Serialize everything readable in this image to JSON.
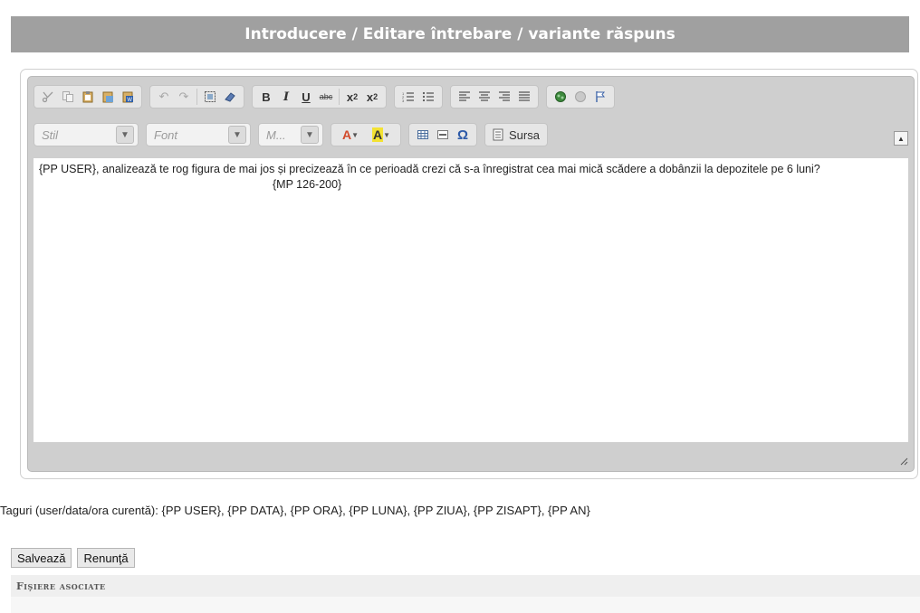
{
  "dialog": {
    "title": "Introducere / Editare întrebare / variante răspuns"
  },
  "toolbar": {
    "row1_icons": [
      "cut-icon",
      "copy-icon",
      "paste-icon",
      "paste-text-icon",
      "paste-word-icon",
      "undo-icon",
      "redo-icon",
      "select-all-icon",
      "remove-format-icon",
      "bold-icon",
      "italic-icon",
      "underline-icon",
      "strike-icon",
      "subscript-icon",
      "superscript-icon",
      "numbered-list-icon",
      "bulleted-list-icon",
      "align-left-icon",
      "align-center-icon",
      "align-right-icon",
      "justify-icon",
      "link-icon",
      "unlink-icon",
      "anchor-icon"
    ],
    "style_combo": "Stil",
    "font_combo": "Font",
    "size_combo": "M...",
    "source_label": "Sursa"
  },
  "editor": {
    "line1": "{PP USER}, analizează te rog figura de mai jos și precizează în ce perioadă crezi că s-a înregistrat cea mai mică scădere a dobânzii la depozitele pe 6 luni?",
    "line2": "{MP 126-200}"
  },
  "tags": {
    "text": "Taguri (user/data/ora curentă): {PP USER}, {PP DATA}, {PP ORA}, {PP LUNA}, {PP ZIUA}, {PP ZISAPT}, {PP AN}"
  },
  "actions": {
    "save_label": "Salvează",
    "cancel_label": "Renunţă"
  },
  "files": {
    "header": "Fişiere asociate"
  },
  "colors": {
    "title_bar": "#a0a0a0",
    "editor_frame": "#cfcfcf",
    "toolbar_group": "#e6e6e6"
  }
}
